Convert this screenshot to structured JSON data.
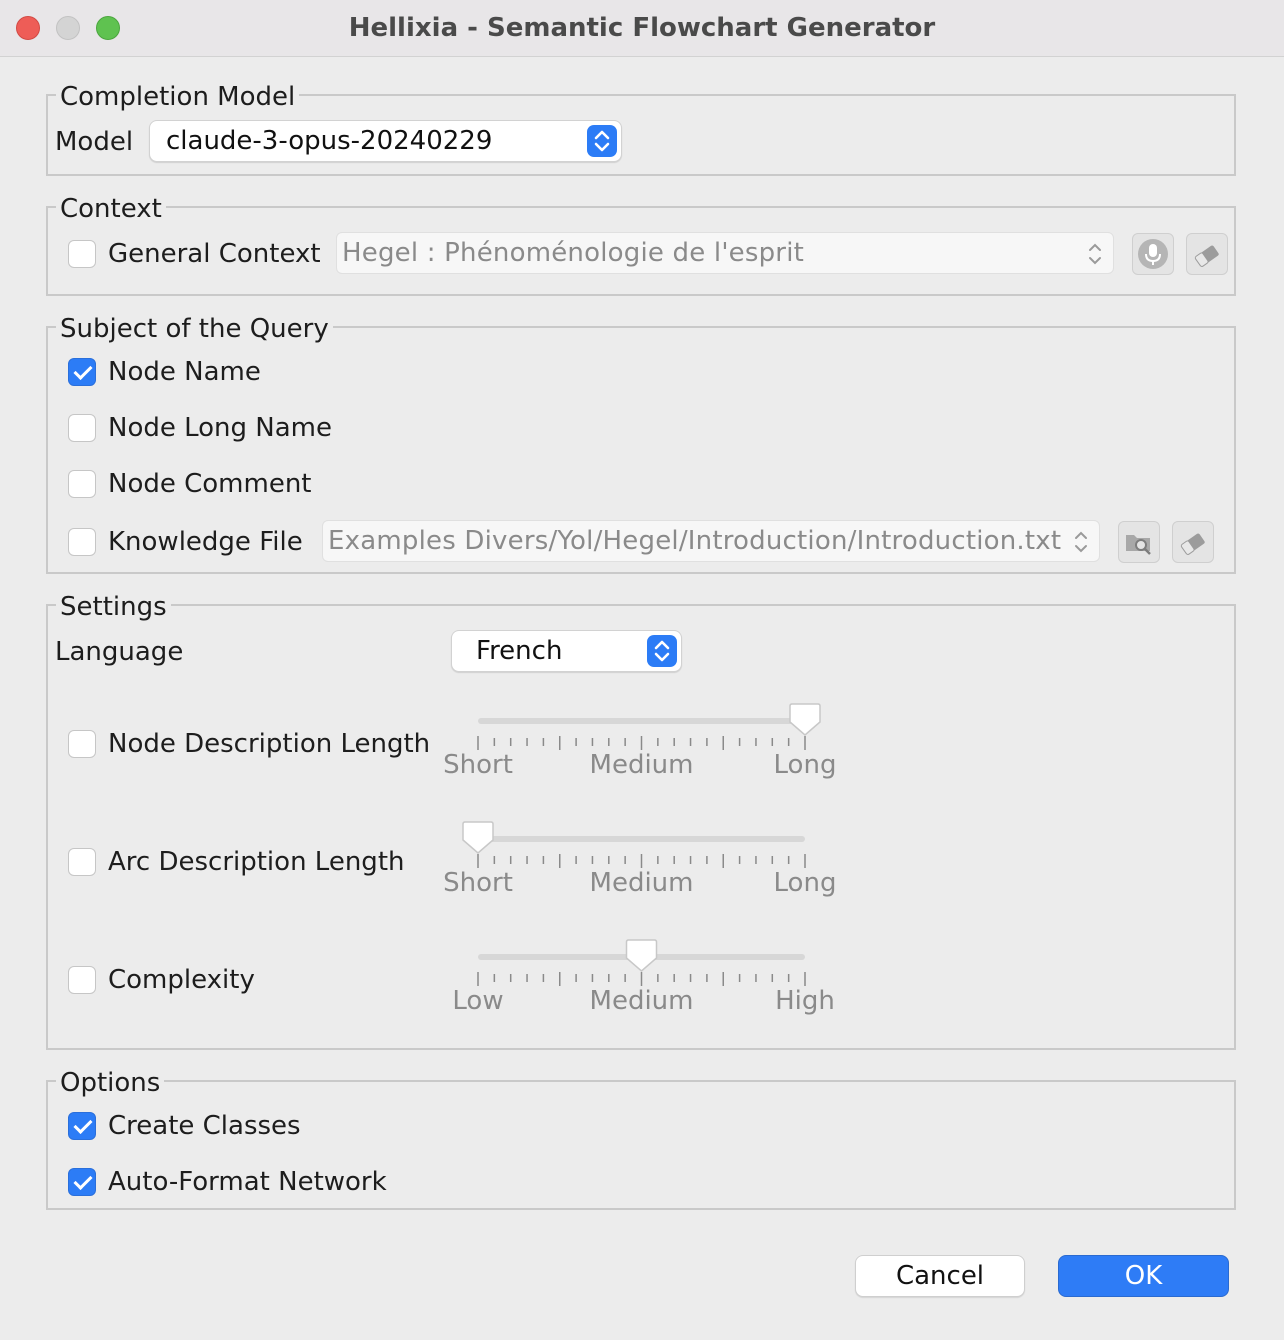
{
  "window": {
    "title": "Hellixia - Semantic Flowchart Generator"
  },
  "completion_model": {
    "section_title": "Completion Model",
    "model_label": "Model",
    "model_value": "claude-3-opus-20240229"
  },
  "context": {
    "section_title": "Context",
    "general_context_label": "General Context",
    "general_context_checked": false,
    "general_context_value": "Hegel : Phénoménologie de l'esprit",
    "icons": [
      "microphone-icon",
      "eraser-icon"
    ]
  },
  "subject": {
    "section_title": "Subject of the Query",
    "items": [
      {
        "label": "Node Name",
        "checked": true
      },
      {
        "label": "Node Long Name",
        "checked": false
      },
      {
        "label": "Node Comment",
        "checked": false
      },
      {
        "label": "Knowledge File",
        "checked": false
      }
    ],
    "knowledge_file_value": "Examples Divers/Yol/Hegel/Introduction/Introduction.txt",
    "icons": [
      "folder-search-icon",
      "eraser-icon"
    ]
  },
  "settings": {
    "section_title": "Settings",
    "language_label": "Language",
    "language_value": "French",
    "sliders": [
      {
        "label": "Node Description Length",
        "checked": false,
        "ticks": [
          "Short",
          "Medium",
          "Long"
        ],
        "value_fraction": 1.0
      },
      {
        "label": "Arc Description Length",
        "checked": false,
        "ticks": [
          "Short",
          "Medium",
          "Long"
        ],
        "value_fraction": 0.0
      },
      {
        "label": "Complexity",
        "checked": false,
        "ticks": [
          "Low",
          "Medium",
          "High"
        ],
        "value_fraction": 0.5
      }
    ]
  },
  "options": {
    "section_title": "Options",
    "items": [
      {
        "label": "Create Classes",
        "checked": true
      },
      {
        "label": "Auto-Format Network",
        "checked": true
      }
    ]
  },
  "buttons": {
    "cancel": "Cancel",
    "ok": "OK"
  },
  "colors": {
    "accent": "#2c7cf6",
    "window_bg": "#ececec"
  }
}
